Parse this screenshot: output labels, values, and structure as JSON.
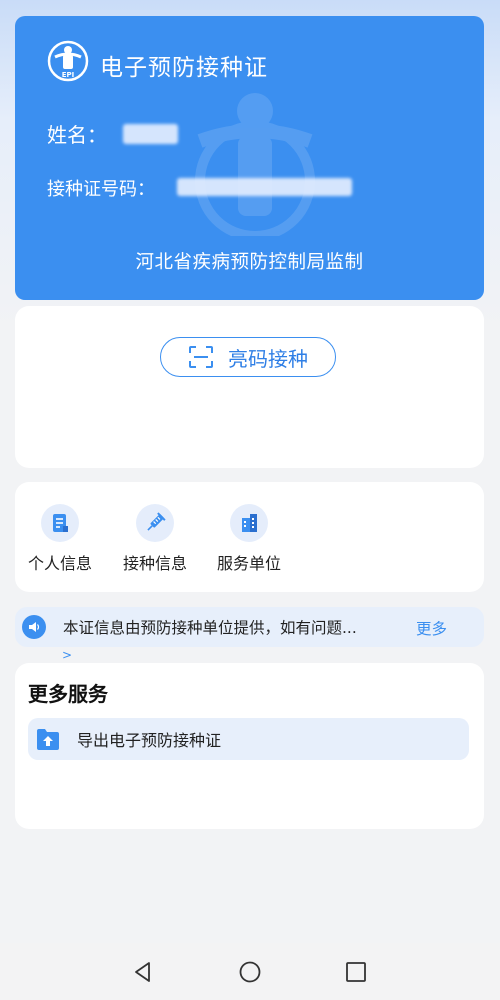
{
  "card": {
    "title": "电子预防接种证",
    "name_label": "姓名：",
    "cert_label": "接种证号码：",
    "footer": "河北省疾病预防控制局监制",
    "logo_text": "EPI",
    "brand_color": "#3b8ff0"
  },
  "code_button": {
    "label": "亮码接种",
    "icon": "scan-frame-icon"
  },
  "menu": [
    {
      "label": "个人信息",
      "icon": "document-icon"
    },
    {
      "label": "接种信息",
      "icon": "syringe-icon"
    },
    {
      "label": "服务单位",
      "icon": "building-icon"
    }
  ],
  "notice": {
    "text": "本证信息由预防接种单位提供，如有问题...",
    "more": "更多",
    "chevron": ">",
    "icon": "speaker-icon"
  },
  "services": {
    "title": "更多服务",
    "items": [
      {
        "label": "导出电子预防接种证",
        "icon": "upload-folder-icon"
      }
    ]
  },
  "navbar": {
    "icons": [
      "back-triangle-icon",
      "home-circle-icon",
      "recent-square-icon"
    ]
  }
}
